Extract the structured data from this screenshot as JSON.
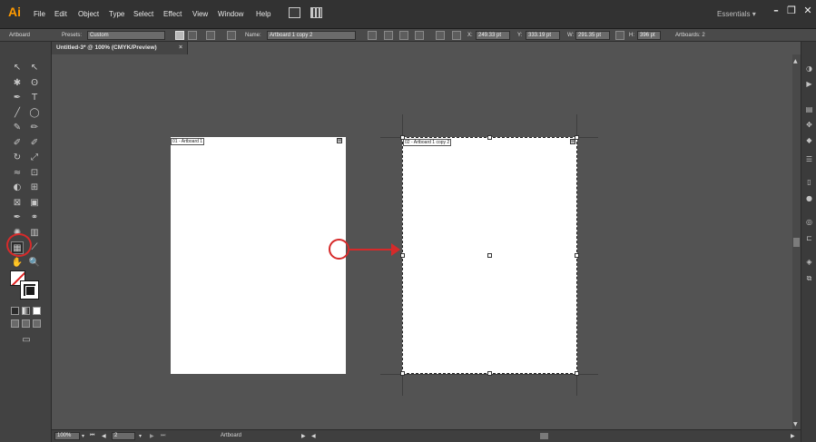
{
  "app": {
    "logo": "Ai"
  },
  "menu": {
    "items": [
      "File",
      "Edit",
      "Object",
      "Type",
      "Select",
      "Effect",
      "View",
      "Window",
      "Help"
    ],
    "workspace": "Essentials",
    "workspace_arrow": "▾",
    "window_buttons": {
      "minimize": "–",
      "restore": "❐",
      "close": "✕"
    }
  },
  "control_bar": {
    "mode_label": "Artboard",
    "presets_label": "Presets:",
    "presets_value": "Custom",
    "name_label": "Name:",
    "name_value": "Artboard 1 copy 2",
    "x_label": "X:",
    "x_value": "249.33 pt",
    "y_label": "Y:",
    "y_value": "333.19 pt",
    "w_label": "W:",
    "w_value": "291.35 pt",
    "h_label": "H:",
    "h_value": "396 pt",
    "artboards_label": "Artboards: 2"
  },
  "document": {
    "tab_title": "Untitled-3* @ 100% (CMYK/Preview)",
    "tab_close": "×"
  },
  "tools": [
    {
      "name": "selection-tool-icon",
      "glyph": "↖"
    },
    {
      "name": "direct-selection-tool-icon",
      "glyph": "↖"
    },
    {
      "name": "magic-wand-tool-icon",
      "glyph": "✱"
    },
    {
      "name": "lasso-tool-icon",
      "glyph": "ʘ"
    },
    {
      "name": "pen-tool-icon",
      "glyph": "✒"
    },
    {
      "name": "type-tool-icon",
      "glyph": "T"
    },
    {
      "name": "line-tool-icon",
      "glyph": "╱"
    },
    {
      "name": "ellipse-tool-icon",
      "glyph": "◯"
    },
    {
      "name": "paintbrush-tool-icon",
      "glyph": "✎"
    },
    {
      "name": "pencil-tool-icon",
      "glyph": "✏"
    },
    {
      "name": "blob-brush-tool-icon",
      "glyph": "✐"
    },
    {
      "name": "eraser-tool-icon",
      "glyph": "✐"
    },
    {
      "name": "rotate-tool-icon",
      "glyph": "↻"
    },
    {
      "name": "scale-tool-icon",
      "glyph": "⤢"
    },
    {
      "name": "width-tool-icon",
      "glyph": "≈"
    },
    {
      "name": "free-transform-tool-icon",
      "glyph": "⊡"
    },
    {
      "name": "shape-builder-tool-icon",
      "glyph": "◐"
    },
    {
      "name": "perspective-grid-tool-icon",
      "glyph": "⊞"
    },
    {
      "name": "mesh-tool-icon",
      "glyph": "⊠"
    },
    {
      "name": "gradient-tool-icon",
      "glyph": "▣"
    },
    {
      "name": "eyedropper-tool-icon",
      "glyph": "✒"
    },
    {
      "name": "blend-tool-icon",
      "glyph": "⚭"
    },
    {
      "name": "symbol-sprayer-tool-icon",
      "glyph": "✺"
    },
    {
      "name": "column-graph-tool-icon",
      "glyph": "▥"
    },
    {
      "name": "artboard-tool-icon",
      "glyph": "▦"
    },
    {
      "name": "slice-tool-icon",
      "glyph": "⟋"
    },
    {
      "name": "hand-tool-icon",
      "glyph": "✋"
    },
    {
      "name": "zoom-tool-icon",
      "glyph": "🔍"
    }
  ],
  "artboards": [
    {
      "label": "01 - Artboard 1",
      "close": "⊠"
    },
    {
      "label": "02 - Artboard 1 copy 2",
      "close": "⊠"
    }
  ],
  "status_bar": {
    "zoom": "100%",
    "first": "⏮",
    "prev": "◀",
    "page": "2",
    "next": "▶",
    "last": "⏭",
    "tool_name": "Artboard",
    "play": "▶",
    "back": "◀"
  },
  "colors": {
    "accent_annotation": "#d62a2a",
    "logo": "#ff9a00",
    "canvas": "#535353"
  }
}
